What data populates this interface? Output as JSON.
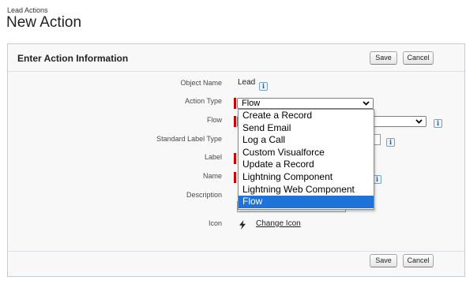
{
  "header": {
    "breadcrumb": "Lead Actions",
    "title": "New Action"
  },
  "panel": {
    "title": "Enter Action Information",
    "save_label": "Save",
    "cancel_label": "Cancel"
  },
  "form": {
    "object_name": {
      "label": "Object Name",
      "value": "Lead"
    },
    "action_type": {
      "label": "Action Type",
      "value": "Flow"
    },
    "flow": {
      "label": "Flow"
    },
    "standard_label_type": {
      "label": "Standard Label Type"
    },
    "label": {
      "label": "Label"
    },
    "name": {
      "label": "Name"
    },
    "description": {
      "label": "Description"
    },
    "icon": {
      "label": "Icon",
      "change_link": "Change Icon"
    }
  },
  "dropdown": {
    "options": [
      "Create a Record",
      "Send Email",
      "Log a Call",
      "Custom Visualforce",
      "Update a Record",
      "Lightning Component",
      "Lightning Web Component",
      "Flow"
    ],
    "selected": "Flow"
  },
  "icons": {
    "info": "info-icon",
    "chevron": "chevron-down-icon",
    "icon_preview": "lightning-bolt-icon"
  },
  "colors": {
    "required_marker": "#cc0000",
    "selected_option_bg": "#1e73d9",
    "info_icon": "#2a5a9a"
  }
}
